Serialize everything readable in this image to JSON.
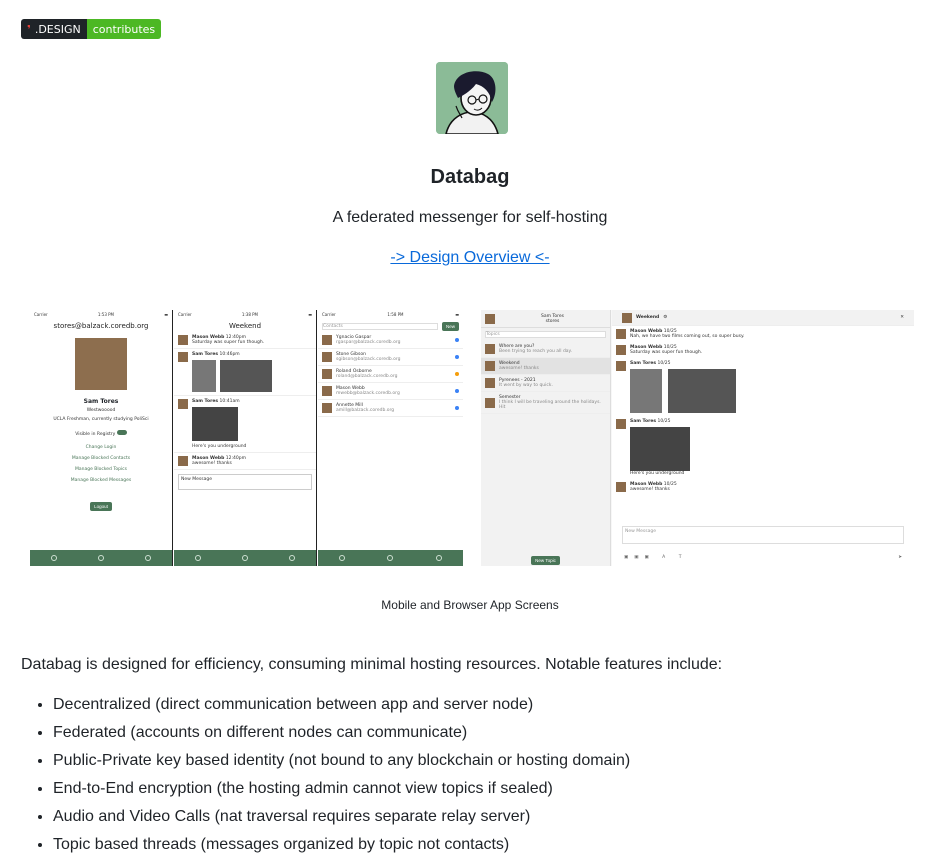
{
  "badge": {
    "brand": ".DESIGN",
    "label": "contributes"
  },
  "header": {
    "title": "Databag",
    "subtitle": "A federated messenger for self-hosting",
    "link_label": "-> Design Overview <-"
  },
  "screens": {
    "caption": "Mobile and Browser App Screens",
    "mobile": {
      "profile": {
        "time": "1:53 PM",
        "carrier": "Carrier",
        "handle": "stores@balzack.coredb.org",
        "name": "Sam Tores",
        "location": "Westwooood",
        "description": "UCLA Freshman, currently studying PoliSci",
        "registry_label": "Visible in Registry",
        "links": [
          "Change Login",
          "Manage Blocked Contacts",
          "Manage Blocked Topics",
          "Manage Blocked Messages"
        ],
        "logout": "Logout"
      },
      "chat": {
        "time": "1:38 PM",
        "title": "Weekend",
        "messages": [
          {
            "author": "Mason Webb",
            "time": "12:40pm",
            "text": "Saturday was super fun though."
          },
          {
            "author": "Sam Tores",
            "time": "10:46pm",
            "text": ""
          },
          {
            "author": "Sam Tores",
            "time": "10:41am",
            "text": "Here's you underground"
          },
          {
            "author": "Mason Webb",
            "time": "12:40pm",
            "text": "awesome! thanks"
          }
        ],
        "input_placeholder": "New Message"
      },
      "contacts": {
        "time": "1:58 PM",
        "search_placeholder": "Contacts",
        "new_label": "New",
        "items": [
          {
            "name": "Ygnacio Gaspar",
            "handle": "rgaspar@balzack.coredb.org",
            "status": "#3b82f6"
          },
          {
            "name": "Stone Gibson",
            "handle": "sgibson@balzack.coredb.org",
            "status": "#3b82f6"
          },
          {
            "name": "Roland Osborne",
            "handle": "roland@balzack.coredb.org",
            "status": "#f59e0b"
          },
          {
            "name": "Mason Webb",
            "handle": "mwebb@balzack.coredb.org",
            "status": "#3b82f6"
          },
          {
            "name": "Annette Mill",
            "handle": "amill@balzack.coredb.org",
            "status": "#3b82f6"
          }
        ]
      }
    },
    "browser": {
      "user": {
        "name": "Sam Tores",
        "handle": "stores"
      },
      "search_placeholder": "Topics",
      "topics": [
        {
          "title": "Where are you?",
          "preview": "Been trying to reach you all day."
        },
        {
          "title": "Weekend",
          "preview": "awesome! thanks"
        },
        {
          "title": "Pyrenees - 2021",
          "preview": "It went by way to quick."
        },
        {
          "title": "Semester",
          "preview": "I think I will be traveling around the holidays. Hit"
        }
      ],
      "new_topic": "New Topic",
      "chat_title": "Weekend",
      "messages": [
        {
          "author": "Mason Webb",
          "time": "10/25",
          "text": "Nah, we have two films coming out, so super busy."
        },
        {
          "author": "Mason Webb",
          "time": "10/25",
          "text": "Saturday was super fun though."
        },
        {
          "author": "Sam Tores",
          "time": "10/25",
          "text": ""
        },
        {
          "author": "Sam Tores",
          "time": "10/25",
          "text": "Here's you underground"
        },
        {
          "author": "Mason Webb",
          "time": "10/25",
          "text": "awesome! thanks"
        }
      ],
      "input_placeholder": "New Message"
    }
  },
  "intro": "Databag is designed for efficiency, consuming minimal hosting resources. Notable features include:",
  "features": [
    "Decentralized (direct communication between app and server node)",
    "Federated (accounts on different nodes can communicate)",
    "Public-Private key based identity (not bound to any blockchain or hosting domain)",
    "End-to-End encryption (the hosting admin cannot view topics if sealed)",
    "Audio and Video Calls (nat traversal requires separate relay server)",
    "Topic based threads (messages organized by topic not contacts)"
  ]
}
